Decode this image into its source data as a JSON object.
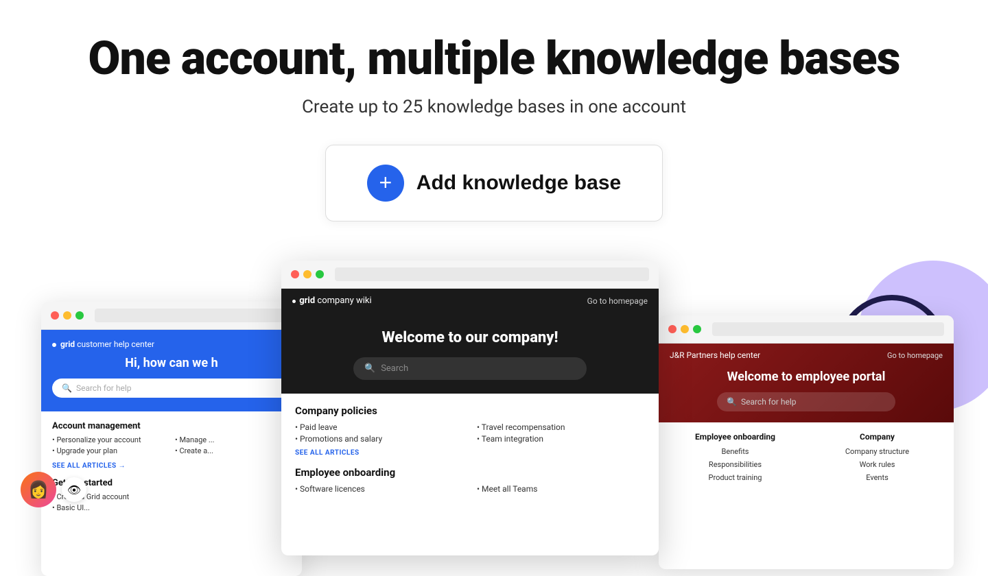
{
  "hero": {
    "title": "One account, multiple knowledge bases",
    "subtitle": "Create up to 25 knowledge bases in one account",
    "add_button_label": "Add knowledge base"
  },
  "left_browser": {
    "brand": "grid",
    "brand_type": "customer help center",
    "hero_title": "Hi, how can we h",
    "search_placeholder": "Search for help",
    "section1_title": "Account management",
    "section1_links": [
      "• Personalize your account",
      "• Manage ...",
      "• Upgrade your plan",
      "• Create a..."
    ],
    "see_all": "SEE ALL ARTICLES →",
    "section2_title": "Getting started",
    "section2_links": [
      "• Create a Grid account",
      "• Basic UI..."
    ]
  },
  "center_browser": {
    "brand": "grid",
    "brand_type": "company wiki",
    "nav_link": "Go to homepage",
    "hero_title": "Welcome to our company!",
    "search_placeholder": "Search",
    "section1_title": "Company policies",
    "section1_links": [
      "• Paid leave",
      "• Travel recompensation",
      "• Promotions and salary",
      "• Team integration"
    ],
    "see_all": "SEE ALL ARTICLES",
    "section2_title": "Employee onboarding",
    "section2_links": [
      "• Software licences",
      "• Meet all Teams"
    ]
  },
  "right_browser": {
    "brand": "J&R Partners",
    "brand_type": "help center",
    "nav_link": "Go to homepage",
    "hero_title": "Welcome to employee portal",
    "search_placeholder": "Search for help",
    "col1_title": "Employee onboarding",
    "col1_links": [
      "Benefits",
      "Responsibilities",
      "Product training"
    ],
    "col2_title": "Company",
    "col2_links": [
      "Company structure",
      "Work rules",
      "Events"
    ]
  },
  "icons": {
    "plus": "+",
    "search": "🔍",
    "eye": "👁",
    "avatar_emoji": "👩"
  }
}
